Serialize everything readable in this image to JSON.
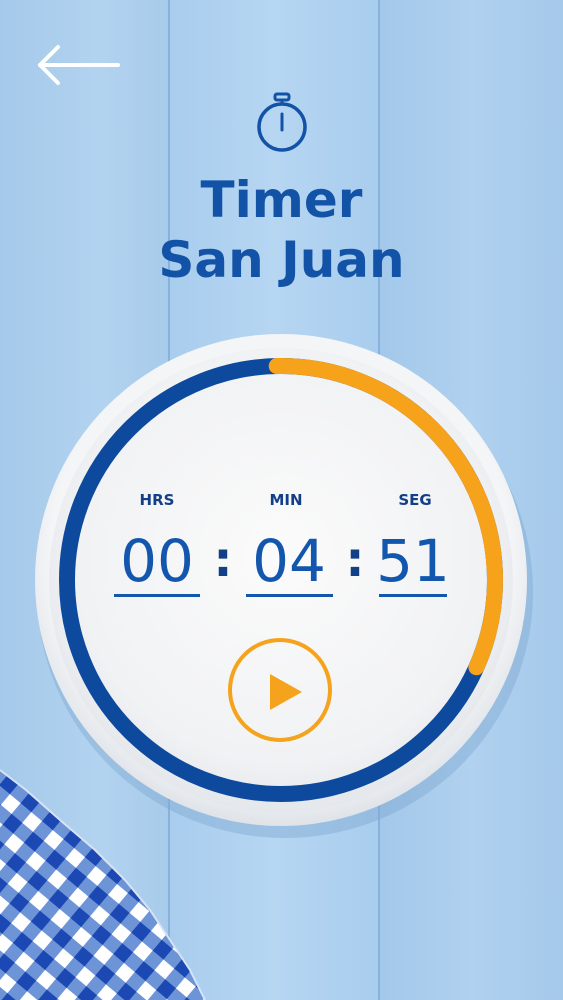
{
  "header": {
    "back_icon": "arrow-left-icon",
    "timer_icon": "stopwatch-icon"
  },
  "title": {
    "line1": "Timer",
    "line2": "San Juan"
  },
  "timer": {
    "hours_label": "HRS",
    "minutes_label": "MIN",
    "seconds_label": "SEG",
    "hours": "00",
    "minutes": "04",
    "seconds": "51",
    "separator": ":",
    "remaining_fraction": 0.32
  },
  "controls": {
    "play_icon": "play-icon"
  },
  "colors": {
    "accent_orange": "#f7a21b",
    "brand_blue": "#1353a7",
    "ring_blue": "#0d4a9e",
    "background": "#a9cdec"
  }
}
